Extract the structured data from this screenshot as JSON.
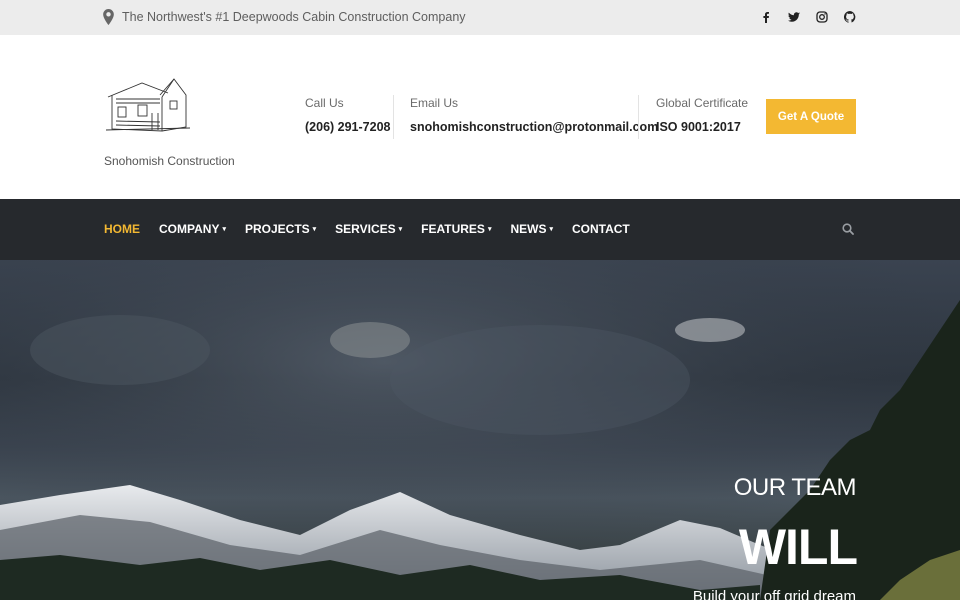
{
  "topbar": {
    "tagline": "The Northwest's #1 Deepwoods Cabin Construction Company",
    "location_icon": "map-marker-icon",
    "social": [
      "facebook-icon",
      "twitter-icon",
      "instagram-icon",
      "github-icon"
    ]
  },
  "header": {
    "logo_text": "Snohomish Construction",
    "call": {
      "label": "Call Us",
      "value": "(206) 291-7208"
    },
    "email": {
      "label": "Email Us",
      "value": "snohomishconstruction@protonmail.com"
    },
    "cert": {
      "label": "Global Certificate",
      "value": "ISO 9001:2017"
    },
    "quote_button": "Get A Quote"
  },
  "nav": {
    "items": [
      {
        "label": "HOME",
        "active": true,
        "dropdown": false
      },
      {
        "label": "COMPANY",
        "dropdown": true
      },
      {
        "label": "PROJECTS",
        "dropdown": true
      },
      {
        "label": "SERVICES",
        "dropdown": true
      },
      {
        "label": "FEATURES",
        "dropdown": true
      },
      {
        "label": "NEWS",
        "dropdown": true
      },
      {
        "label": "CONTACT",
        "dropdown": false
      }
    ],
    "chevron": "▾"
  },
  "hero": {
    "line1": "OUR TEAM",
    "line2": "WILL",
    "line3": "Build your off grid dream"
  },
  "colors": {
    "accent": "#f3b832",
    "nav_bg": "#26292d",
    "topbar_bg": "#ececec"
  }
}
